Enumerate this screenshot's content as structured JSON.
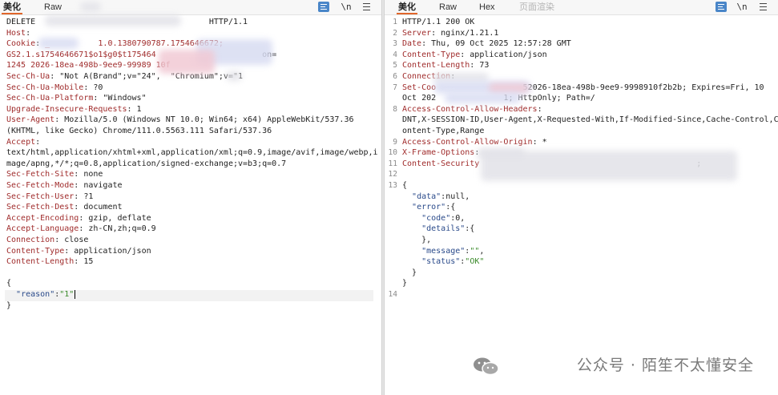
{
  "left_pane": {
    "tabs": [
      {
        "label": "美化",
        "active": true
      },
      {
        "label": "Raw",
        "active": false
      }
    ],
    "toolbar": {
      "newline_label": "\\n"
    },
    "request_lines": [
      [
        {
          "c": "hv",
          "v": "DELETE "
        },
        {
          "c": "hv",
          "v": "                                   HTTP/1.1"
        }
      ],
      [
        {
          "c": "hk",
          "v": "Host"
        },
        {
          "c": "hv",
          "v": ":"
        }
      ],
      [
        {
          "c": "hk",
          "v": "Cookie"
        },
        {
          "c": "hv",
          "v": ": "
        },
        {
          "c": "ckey",
          "v": "_          1.0.1380790787.1754646672;"
        }
      ],
      [
        {
          "c": "ckey",
          "v": "GS2.1.s1754646671$o1$g0$t175464"
        },
        {
          "c": "hv",
          "v": "                      on="
        }
      ],
      [
        {
          "c": "ckey",
          "v": "1245 2026-18ea-498b-9ee9-99989 10f"
        }
      ],
      [
        {
          "c": "hk",
          "v": "Sec-Ch-Ua"
        },
        {
          "c": "hv",
          "v": ": \"Not A(Brand\";v=\"24\",  \"Chromium\";v=\"1"
        }
      ],
      [
        {
          "c": "hk",
          "v": "Sec-Ch-Ua-Mobile"
        },
        {
          "c": "hv",
          "v": ": ?0"
        }
      ],
      [
        {
          "c": "hk",
          "v": "Sec-Ch-Ua-Platform"
        },
        {
          "c": "hv",
          "v": ": \"Windows\""
        }
      ],
      [
        {
          "c": "hk",
          "v": "Upgrade-Insecure-Requests"
        },
        {
          "c": "hv",
          "v": ": 1"
        }
      ],
      [
        {
          "c": "hk",
          "v": "User-Agent"
        },
        {
          "c": "hv",
          "v": ": Mozilla/5.0 (Windows NT 10.0; Win64; x64) AppleWebKit/537.36"
        }
      ],
      [
        {
          "c": "hv",
          "v": "(KHTML, like Gecko) Chrome/111.0.5563.111 Safari/537.36"
        }
      ],
      [
        {
          "c": "hk",
          "v": "Accept"
        },
        {
          "c": "hv",
          "v": ":"
        }
      ],
      [
        {
          "c": "hv",
          "v": "text/html,application/xhtml+xml,application/xml;q=0.9,image/avif,image/webp,i"
        }
      ],
      [
        {
          "c": "hv",
          "v": "mage/apng,*/*;q=0.8,application/signed-exchange;v=b3;q=0.7"
        }
      ],
      [
        {
          "c": "hk",
          "v": "Sec-Fetch-Site"
        },
        {
          "c": "hv",
          "v": ": none"
        }
      ],
      [
        {
          "c": "hk",
          "v": "Sec-Fetch-Mode"
        },
        {
          "c": "hv",
          "v": ": navigate"
        }
      ],
      [
        {
          "c": "hk",
          "v": "Sec-Fetch-User"
        },
        {
          "c": "hv",
          "v": ": ?1"
        }
      ],
      [
        {
          "c": "hk",
          "v": "Sec-Fetch-Dest"
        },
        {
          "c": "hv",
          "v": ": document"
        }
      ],
      [
        {
          "c": "hk",
          "v": "Accept-Encoding"
        },
        {
          "c": "hv",
          "v": ": gzip, deflate"
        }
      ],
      [
        {
          "c": "hk",
          "v": "Accept-Language"
        },
        {
          "c": "hv",
          "v": ": zh-CN,zh;q=0.9"
        }
      ],
      [
        {
          "c": "hk",
          "v": "Connection"
        },
        {
          "c": "hv",
          "v": ": close"
        }
      ],
      [
        {
          "c": "hk",
          "v": "Content-Type"
        },
        {
          "c": "hv",
          "v": ": application/json"
        }
      ],
      [
        {
          "c": "hk",
          "v": "Content-Length"
        },
        {
          "c": "hv",
          "v": ": 15"
        }
      ],
      [],
      [
        {
          "c": "jp",
          "v": "{"
        }
      ],
      [
        {
          "c": "jp",
          "v": "  "
        },
        {
          "c": "jk",
          "v": "\"reason\""
        },
        {
          "c": "jp",
          "v": ":"
        },
        {
          "c": "js",
          "v": "\"1\""
        }
      ],
      [
        {
          "c": "jp",
          "v": "}"
        }
      ]
    ]
  },
  "right_pane": {
    "tabs": [
      {
        "label": "美化",
        "active": true
      },
      {
        "label": "Raw",
        "active": false
      },
      {
        "label": "Hex",
        "active": false
      },
      {
        "label": "页面渲染",
        "active": false
      }
    ],
    "toolbar": {
      "newline_label": "\\n"
    },
    "response_lines": [
      {
        "n": "1",
        "parts": [
          {
            "c": "hv",
            "v": "HTTP/1.1 200 OK"
          }
        ]
      },
      {
        "n": "2",
        "parts": [
          {
            "c": "hk",
            "v": "Server"
          },
          {
            "c": "hv",
            "v": ": nginx/1.21.1"
          }
        ]
      },
      {
        "n": "3",
        "parts": [
          {
            "c": "hk",
            "v": "Date"
          },
          {
            "c": "hv",
            "v": ": Thu, 09 Oct 2025 12:57:28 GMT"
          }
        ]
      },
      {
        "n": "4",
        "parts": [
          {
            "c": "hk",
            "v": "Content-Type"
          },
          {
            "c": "hv",
            "v": ": application/json"
          }
        ]
      },
      {
        "n": "5",
        "parts": [
          {
            "c": "hk",
            "v": "Content-Length"
          },
          {
            "c": "hv",
            "v": ": 73"
          }
        ]
      },
      {
        "n": "6",
        "parts": [
          {
            "c": "hk",
            "v": "Connection"
          },
          {
            "c": "hv",
            "v": ":"
          }
        ]
      },
      {
        "n": "7",
        "parts": [
          {
            "c": "hk",
            "v": "Set-Coo"
          },
          {
            "c": "hv",
            "v": "                  52026-18ea-498b-9ee9-9998910f2b2b; Expires=Fri, 10"
          }
        ]
      },
      {
        "n": "",
        "parts": [
          {
            "c": "hv",
            "v": "Oct 202              1; HttpOnly; Path=/"
          }
        ]
      },
      {
        "n": "8",
        "parts": [
          {
            "c": "hk",
            "v": "Access-Control-Allow-Headers"
          },
          {
            "c": "hv",
            "v": ":"
          }
        ]
      },
      {
        "n": "",
        "parts": [
          {
            "c": "hv",
            "v": "DNT,X-SESSION-ID,User-Agent,X-Requested-With,If-Modified-Since,Cache-Control,C"
          }
        ]
      },
      {
        "n": "",
        "parts": [
          {
            "c": "hv",
            "v": "ontent-Type,Range"
          }
        ]
      },
      {
        "n": "9",
        "parts": [
          {
            "c": "hk",
            "v": "Access-Control-Allow-Origin"
          },
          {
            "c": "hv",
            "v": ": *"
          }
        ]
      },
      {
        "n": "10",
        "parts": [
          {
            "c": "hk",
            "v": "X-Frame-Options"
          },
          {
            "c": "hv",
            "v": ":"
          }
        ]
      },
      {
        "n": "11",
        "parts": [
          {
            "c": "hk",
            "v": "Content-Security"
          },
          {
            "c": "hv",
            "v": "                                             ;"
          }
        ]
      },
      {
        "n": "12",
        "parts": []
      },
      {
        "n": "13",
        "parts": [
          {
            "c": "jp",
            "v": "{"
          }
        ]
      },
      {
        "n": "",
        "parts": [
          {
            "c": "jp",
            "v": "  "
          },
          {
            "c": "jk",
            "v": "\"data\""
          },
          {
            "c": "jp",
            "v": ":null,"
          }
        ]
      },
      {
        "n": "",
        "parts": [
          {
            "c": "jp",
            "v": "  "
          },
          {
            "c": "jk",
            "v": "\"error\""
          },
          {
            "c": "jp",
            "v": ":{"
          }
        ]
      },
      {
        "n": "",
        "parts": [
          {
            "c": "jp",
            "v": "    "
          },
          {
            "c": "jk",
            "v": "\"code\""
          },
          {
            "c": "jp",
            "v": ":0,"
          }
        ]
      },
      {
        "n": "",
        "parts": [
          {
            "c": "jp",
            "v": "    "
          },
          {
            "c": "jk",
            "v": "\"details\""
          },
          {
            "c": "jp",
            "v": ":{"
          }
        ]
      },
      {
        "n": "",
        "parts": [
          {
            "c": "jp",
            "v": "    },"
          }
        ]
      },
      {
        "n": "",
        "parts": [
          {
            "c": "jp",
            "v": "    "
          },
          {
            "c": "jk",
            "v": "\"message\""
          },
          {
            "c": "jp",
            "v": ":"
          },
          {
            "c": "js",
            "v": "\"\""
          },
          {
            "c": "jp",
            "v": ","
          }
        ]
      },
      {
        "n": "",
        "parts": [
          {
            "c": "jp",
            "v": "    "
          },
          {
            "c": "jk",
            "v": "\"status\""
          },
          {
            "c": "jp",
            "v": ":"
          },
          {
            "c": "js",
            "v": "\"OK\""
          }
        ]
      },
      {
        "n": "",
        "parts": [
          {
            "c": "jp",
            "v": "  }"
          }
        ]
      },
      {
        "n": "",
        "parts": [
          {
            "c": "jp",
            "v": "}"
          }
        ]
      },
      {
        "n": "14",
        "parts": []
      }
    ]
  },
  "watermark": {
    "text": "公众号 · 陌笙不太懂安全"
  }
}
